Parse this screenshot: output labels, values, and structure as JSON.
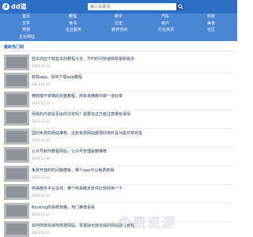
{
  "header": {
    "logo_icon": "site-logo-icon",
    "logo_mark": "d",
    "logo_text": "dd道",
    "search_placeholder": "输入关键词",
    "search_icon": "search-icon"
  },
  "nav": {
    "items": [
      "首页",
      "教程",
      "新手",
      "汽车",
      "科技",
      "文学",
      "读书",
      "历史",
      "用户",
      "美食",
      "宠物",
      "企业服务",
      "教育培训",
      "行业资讯",
      "社区",
      "企业网站"
    ]
  },
  "section": {
    "title": "最新热门网"
  },
  "articles": [
    {
      "title": "蓝伞商店下载蓝伞的教程大全，节约时间快速获取最新版本",
      "meta": "2023-12-11 ·"
    },
    {
      "title": "获取app，如何下载app教程",
      "meta": "2023-12-11 ·"
    },
    {
      "title": "黄鹤楼不锈钢的完整教程，简单易懂教你做一道好菜",
      "meta": "2023-12-11 ·"
    },
    {
      "title": "网易的内容是否由你决定吗？需要在这方面注意哪些事情",
      "meta": "2023-12-11 ·"
    },
    {
      "title": "国内免费的网站推荐，这些免费网站都很好用并且功能非常完善",
      "meta": "2023-12-11 ·"
    },
    {
      "title": "公众号制作教程网站，公众号管理秘籍推荐",
      "meta": "2023-12-11 ·"
    },
    {
      "title": "免费开放的时间轴模板，哪个app可以免费获得",
      "meta": "2023-12-11 ·"
    },
    {
      "title": "简易散步平台在线，哪个简易散步软件比较好用一下",
      "meta": "2023-12-11 ·"
    },
    {
      "title": "Booking的系统攻略，热门推荐看看",
      "meta": "2023-12-11 ·"
    },
    {
      "title": "如何简单快速地搭建网站，零基础也能完成的网站建设教程",
      "meta": "2023-12-11 ·"
    }
  ],
  "watermark": "免费资源"
}
